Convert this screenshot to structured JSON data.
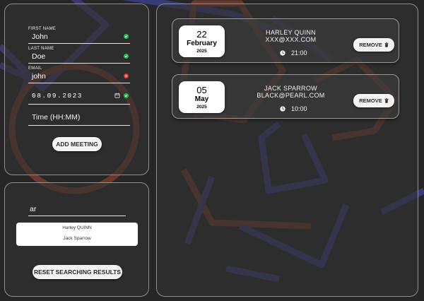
{
  "form": {
    "first_name": {
      "label": "FIRST NAME",
      "value": "John",
      "status": "valid"
    },
    "last_name": {
      "label": "LAST NAME",
      "value": "Doe",
      "status": "valid"
    },
    "email": {
      "label": "EMAIL",
      "value": "john",
      "status": "invalid"
    },
    "date": {
      "value": "08.09.2023",
      "status": "valid",
      "icon": "calendar-icon"
    },
    "time": {
      "placeholder": "Time (HH:MM)"
    },
    "add_button": "ADD MEETING"
  },
  "search": {
    "query": "ar",
    "results": [
      "Harley QUINN",
      "Jack Sparrow"
    ],
    "reset_button": "RESET SEARCHING RESULTS"
  },
  "meetings": [
    {
      "day": "22",
      "month": "February",
      "year": "2025",
      "name": "HARLEY QUINN",
      "email": "XXX@XXX.COM",
      "time": "21:00",
      "remove_label": "REMOVE"
    },
    {
      "day": "05",
      "month": "May",
      "year": "2025",
      "name": "JACK SPARROW",
      "email": "BLACK@PEARL.COM",
      "time": "10:00",
      "remove_label": "REMOVE"
    }
  ],
  "colors": {
    "valid": "#1fbf4f",
    "invalid": "#e23838",
    "panel_border": "#8f8f8f",
    "background": "#262626"
  }
}
